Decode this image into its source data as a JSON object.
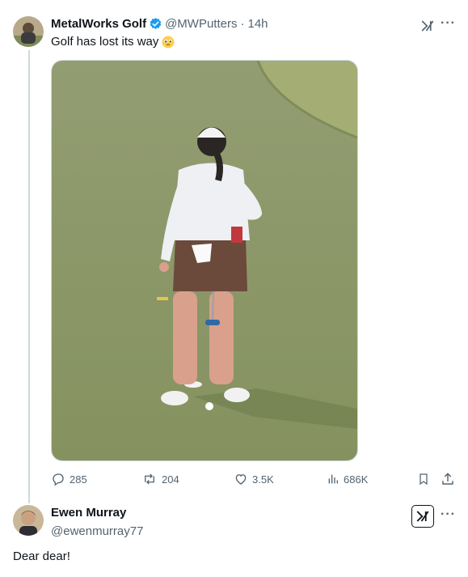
{
  "tweet": {
    "author_name": "MetalWorks Golf",
    "author_handle": "@MWPutters",
    "separator": "·",
    "time": "14h",
    "text": "Golf has lost its way",
    "emoji": "pleading-face",
    "media": "photo of golfer on putting green"
  },
  "actions": {
    "replies": "285",
    "reposts": "204",
    "likes": "3.5K",
    "views": "686K"
  },
  "reply": {
    "author_name": "Ewen Murray",
    "author_handle": "@ewenmurray77",
    "text": "Dear dear!"
  },
  "colors": {
    "verified": "#1d9bf0",
    "muted": "#536471",
    "green": "#8e9a68"
  }
}
